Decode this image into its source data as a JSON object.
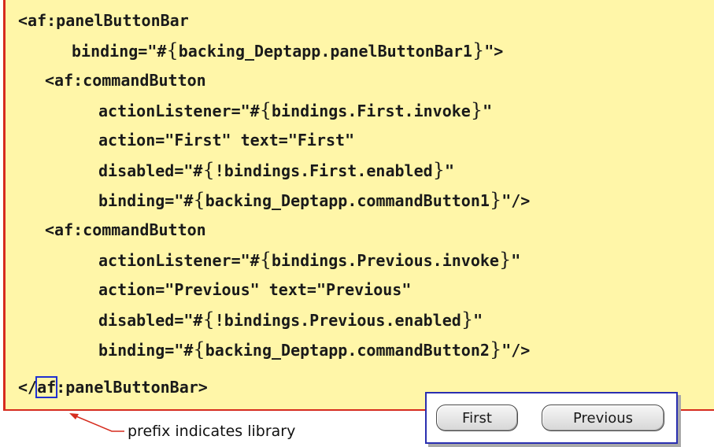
{
  "code": {
    "l1": "<af:panelButtonBar",
    "l2a": "binding=\"#",
    "l2b": "backing_Deptapp.panelButtonBar1",
    "l2c": "\">",
    "l3": "<af:commandButton",
    "l4a": "actionListener=\"#",
    "l4b": "bindings.First.invoke",
    "l4c": "\"",
    "l5": "action=\"First\" text=\"First\"",
    "l6a": "disabled=\"#",
    "l6b": "!bindings.First.enabled",
    "l6c": "\"",
    "l7a": "binding=\"#",
    "l7b": "backing_Deptapp.commandButton1",
    "l7c": "\"/>",
    "l8": "<af:commandButton",
    "l9a": "actionListener=\"#",
    "l9b": "bindings.Previous.invoke",
    "l9c": "\"",
    "l10": "action=\"Previous\" text=\"Previous\"",
    "l11a": "disabled=\"#",
    "l11b": "!bindings.Previous.enabled",
    "l11c": "\"",
    "l12a": "binding=\"#",
    "l12b": "backing_Deptapp.commandButton2",
    "l12c": "\"/>",
    "l13a": "</",
    "l13b": "af",
    "l13c": ":panelButtonBar>",
    "lbrace": "{",
    "rbrace": "}"
  },
  "buttons": {
    "first": "First",
    "previous": "Previous"
  },
  "annotation": "prefix indicates library",
  "colors": {
    "code_background": "#fff6a8",
    "border_red": "#d62c1e",
    "highlight_blue": "#2030d0"
  }
}
